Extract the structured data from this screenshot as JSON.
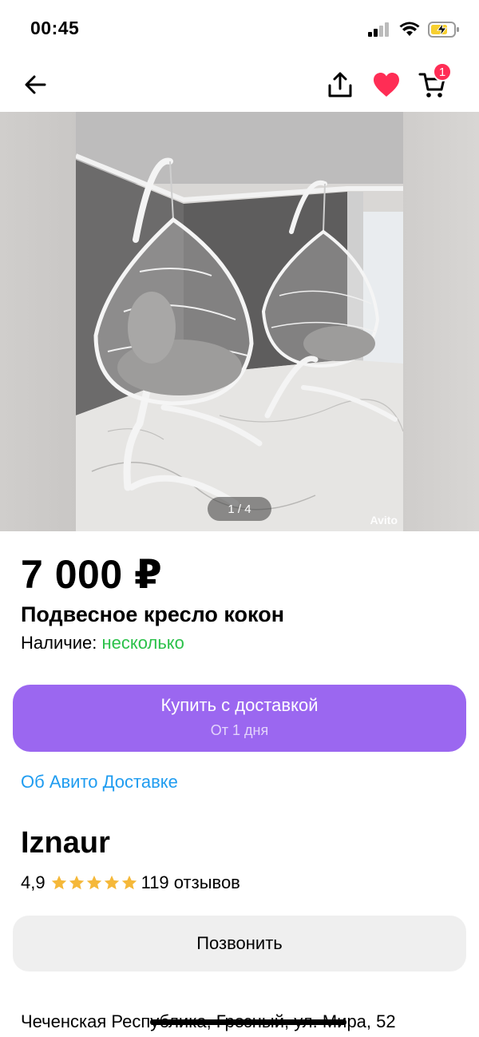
{
  "status": {
    "time": "00:45"
  },
  "nav": {
    "cart_count": "1"
  },
  "gallery": {
    "counter": "1 / 4",
    "watermark": "Avito"
  },
  "listing": {
    "price": "7 000 ₽",
    "title": "Подвесное кресло кокон",
    "availability_label": "Наличие:",
    "availability_value": "несколько"
  },
  "buy_button": {
    "label": "Купить с доставкой",
    "sublabel": "От 1 дня"
  },
  "delivery_link": "Об Авито Доставке",
  "seller": {
    "name": "Iznaur",
    "rating": "4,9",
    "stars": 5,
    "reviews": "119 отзывов"
  },
  "call_button": {
    "label": "Позвонить"
  },
  "address": "Чеченская Республика, Грозный, ул. Мира, 52",
  "colors": {
    "accent_purple": "#9b67f0",
    "link_blue": "#1f9cf0",
    "availability_green": "#2bc14a",
    "favorite_red": "#ff2d55",
    "star_gold": "#f5b839"
  }
}
